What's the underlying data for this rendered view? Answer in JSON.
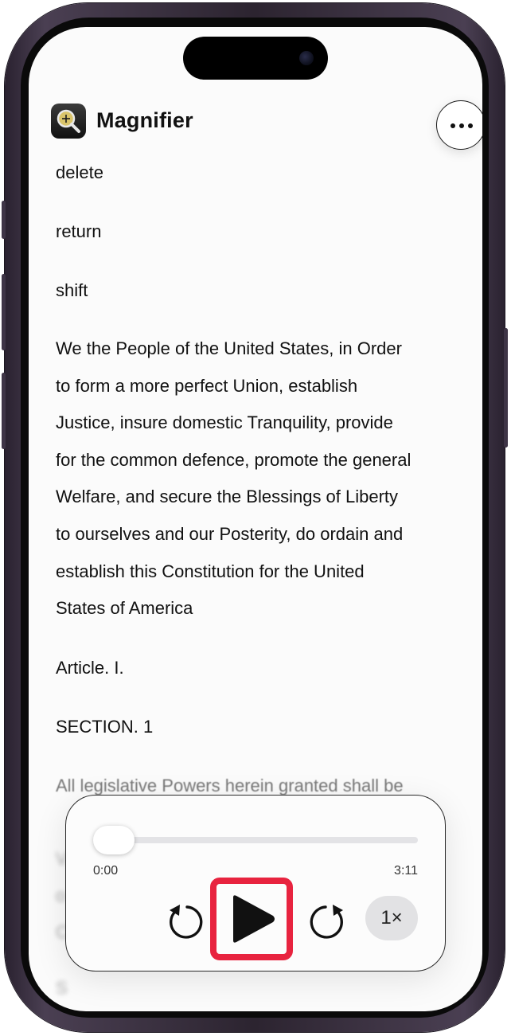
{
  "app": {
    "name": "Magnifier",
    "icon": "magnifier-app-icon",
    "more_icon": "ellipsis-icon"
  },
  "content": {
    "words": [
      "delete",
      "return",
      "shift"
    ],
    "paragraph_lines": [
      "We the People of the United States, in Order",
      "to form a more perfect Union, establish",
      "Justice, insure domestic Tranquility, provide",
      "for the common defence, promote the general",
      "Welfare, and secure the Blessings of Liberty",
      "to ourselves and our Posterity, do ordain and",
      "establish this Constitution for the United",
      "States of America"
    ],
    "article": "Article. I.",
    "section": "SECTION. 1",
    "faded_line": "All legislative Powers herein granted shall be"
  },
  "player": {
    "progress": 0.0,
    "elapsed": "0:00",
    "duration": "3:11",
    "rewind_icon": "skip-back-icon",
    "play_icon": "play-icon",
    "forward_icon": "skip-forward-icon",
    "speed_label": "1×",
    "highlight_color": "#e8233f"
  }
}
